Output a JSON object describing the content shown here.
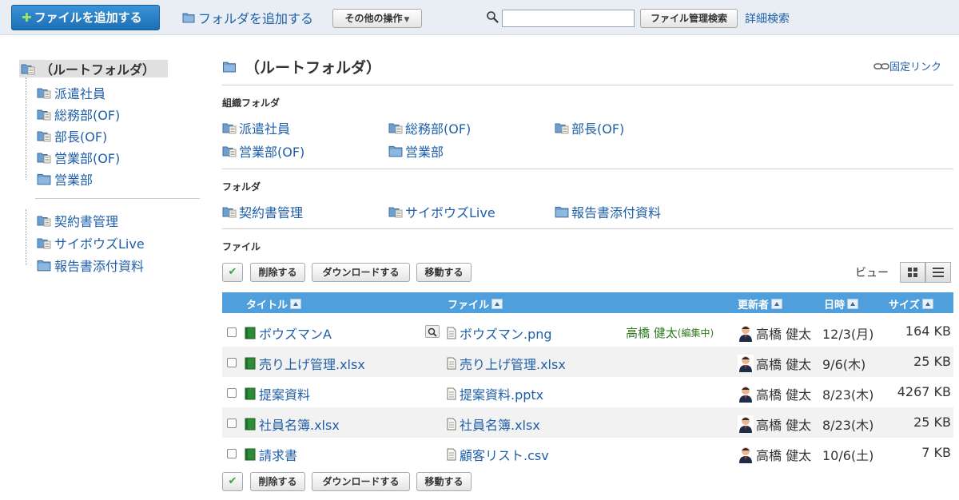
{
  "toolbar": {
    "add_file": "ファイルを追加する",
    "add_folder": "フォルダを追加する",
    "other_actions": "その他の操作",
    "search_placeholder": "",
    "search_button": "ファイル管理検索",
    "advanced_search": "詳細検索"
  },
  "sidebar": {
    "root": "（ルートフォルダ）",
    "org_items": [
      "派遣社員",
      "総務部(OF)",
      "部長(OF)",
      "営業部(OF)",
      "営業部"
    ],
    "folder_items": [
      "契約書管理",
      "サイボウズLive",
      "報告書添付資料"
    ]
  },
  "main": {
    "title": "（ルートフォルダ）",
    "permalink": "固定リンク",
    "org_folders_heading": "組織フォルダ",
    "org_folders": [
      "派遣社員",
      "総務部(OF)",
      "部長(OF)",
      "営業部(OF)",
      "営業部"
    ],
    "folders_heading": "フォルダ",
    "folders": [
      "契約書管理",
      "サイボウズLive",
      "報告書添付資料"
    ],
    "files_heading": "ファイル",
    "actions": {
      "delete": "削除する",
      "download": "ダウンロードする",
      "move": "移動する"
    },
    "view_label": "ビュー"
  },
  "table": {
    "headers": {
      "title": "タイトル",
      "file": "ファイル",
      "updater": "更新者",
      "date": "日時",
      "size": "サイズ"
    },
    "rows": [
      {
        "title": "ボウズマンA",
        "file": "ボウズマン.png",
        "editing_user": "高橋 健太",
        "editing_note": "(編集中)",
        "updater": "高橋 健太",
        "date": "12/3(月)",
        "size": "164 KB"
      },
      {
        "title": "売り上げ管理.xlsx",
        "file": "売り上げ管理.xlsx",
        "updater": "高橋 健太",
        "date": "9/6(木)",
        "size": "25 KB"
      },
      {
        "title": "提案資料",
        "file": "提案資料.pptx",
        "updater": "高橋 健太",
        "date": "8/23(木)",
        "size": "4267 KB"
      },
      {
        "title": "社員名簿.xlsx",
        "file": "社員名簿.xlsx",
        "updater": "高橋 健太",
        "date": "8/23(木)",
        "size": "25 KB"
      },
      {
        "title": "請求書",
        "file": "顧客リスト.csv",
        "updater": "高橋 健太",
        "date": "10/6(土)",
        "size": "7 KB"
      }
    ]
  },
  "colors": {
    "toolbar_bg": "#e8eef4",
    "link": "#1f5fa8",
    "table_header": "#4e9fdb",
    "primary_button": "#1d6fb5"
  }
}
